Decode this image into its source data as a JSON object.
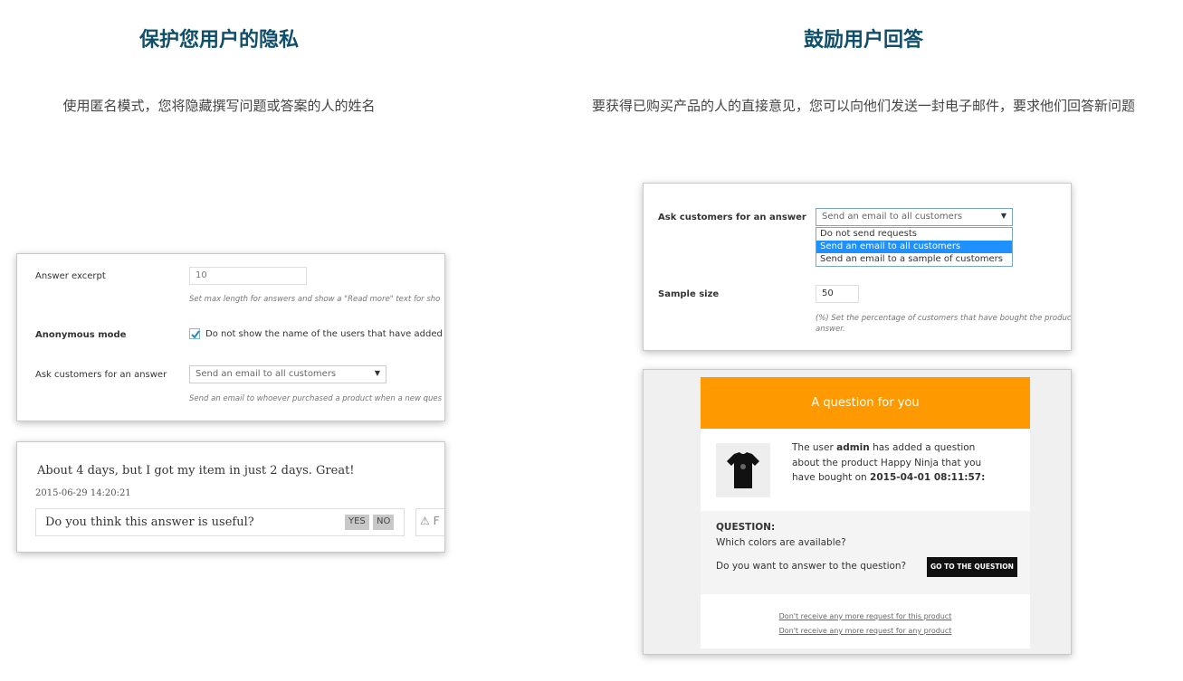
{
  "left": {
    "title": "保护您用户的隐私",
    "description": "使用匿名模式，您将隐藏撰写问题或答案的人的姓名"
  },
  "right": {
    "title": "鼓励用户回答",
    "description": "要获得已购买产品的人的直接意见，您可以向他们发送一封电子邮件，要求他们回答新问题"
  },
  "settings_panel": {
    "answer_excerpt_label": "Answer excerpt",
    "answer_excerpt_value": "10",
    "answer_excerpt_hint": "Set max length for answers and show a \"Read more\" text for sho",
    "anonymous_label": "Anonymous mode",
    "anonymous_checked": true,
    "anonymous_text": "Do not show the name of the users that have added a",
    "ask_label": "Ask customers for an answer",
    "ask_value": "Send an email to all customers",
    "ask_hint": "Send an email to whoever purchased a product when a new ques"
  },
  "review_panel": {
    "text": "About 4 days, but I got my item in just 2 days. Great!",
    "date": "2015-06-29 14:20:21",
    "useful_question": "Do you think this answer is useful?",
    "yes_label": "YES",
    "no_label": "NO",
    "warn_text": "F"
  },
  "ask_panel": {
    "ask_label": "Ask customers for an answer",
    "ask_value": "Send an email to all customers",
    "options": [
      "Do not send requests",
      "Send an email to all customers",
      "Send an email to a sample of customers"
    ],
    "selected_index": 1,
    "sample_label": "Sample size",
    "sample_value": "50",
    "sample_hint_line1": "(%) Set the percentage of customers that have bought the produc",
    "sample_hint_line2": "answer."
  },
  "email_panel": {
    "header": "A question for you",
    "body_prefix": "The user ",
    "body_user": "admin",
    "body_mid": "  has added a question about the product Happy Ninja that you have bought on ",
    "body_date": "2015-04-01 08:11:57:",
    "question_label": "QUESTION:",
    "question_text": "Which colors are available?",
    "answer_prompt": "Do you want to answer to the question?",
    "goto_button": "GO TO THE QUESTION",
    "unsub_product": "Don't receive any more request for this product",
    "unsub_any": "Don't receive any more request for any product"
  },
  "colors": {
    "title": "#0f4f6a",
    "email_header": "#ff9900",
    "dropdown_selected": "#1e90ff",
    "button": "#111111"
  }
}
